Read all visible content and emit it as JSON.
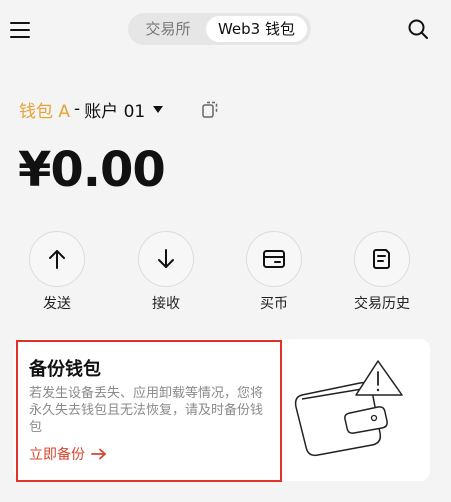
{
  "header": {
    "tabs": [
      "交易所",
      "Web3 钱包"
    ],
    "active_tab": "Web3 钱包"
  },
  "wallet": {
    "name": "钱包 A",
    "separator": "-",
    "account": "账户 01"
  },
  "balance": "¥0.00",
  "actions": [
    {
      "label": "发送",
      "icon": "arrow-up-icon"
    },
    {
      "label": "接收",
      "icon": "arrow-down-icon"
    },
    {
      "label": "买币",
      "icon": "card-icon"
    },
    {
      "label": "交易历史",
      "icon": "history-icon"
    }
  ],
  "backup_card": {
    "title": "备份钱包",
    "description": "若发生设备丢失、应用卸载等情况，您将永久失去钱包且无法恢复，请及时备份钱包",
    "link": "立即备份",
    "illustration_icon": "wallet-warning-illustration"
  },
  "colors": {
    "accent": "#e6a235",
    "link": "#d9452c",
    "highlight_border": "#e0312a"
  }
}
